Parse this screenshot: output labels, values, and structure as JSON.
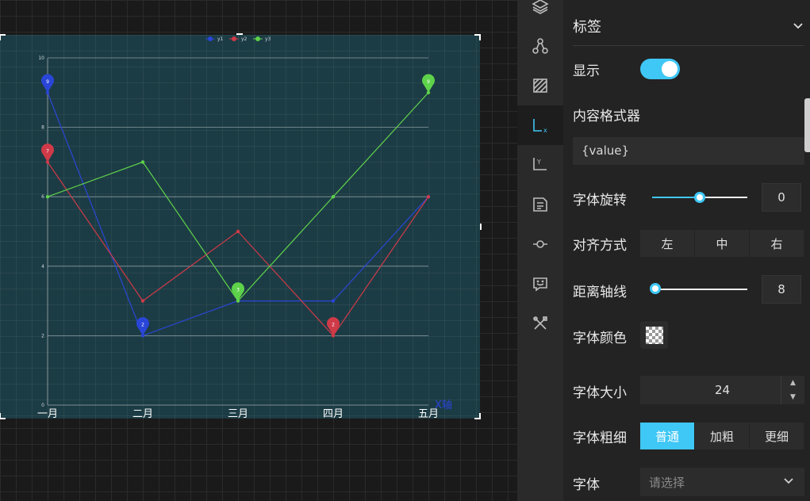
{
  "canvas": {
    "chart_data": {
      "type": "line",
      "categories": [
        "一月",
        "二月",
        "三月",
        "四月",
        "五月"
      ],
      "series": [
        {
          "name": "y1",
          "color": "#2a46d8",
          "values": [
            9,
            2,
            3,
            3,
            6
          ]
        },
        {
          "name": "y2",
          "color": "#cf3a48",
          "values": [
            7,
            3,
            5,
            2,
            6
          ]
        },
        {
          "name": "y3",
          "color": "#5ed24a",
          "values": [
            6,
            7,
            3,
            6,
            9
          ]
        }
      ],
      "ylim": [
        0,
        10
      ],
      "y_ticks": [
        "0",
        "2",
        "4",
        "6",
        "8",
        "10"
      ],
      "xlabel": "X轴",
      "grid": true,
      "legend": "top-center",
      "markers": [
        {
          "series": 0,
          "index": 0,
          "label": "9"
        },
        {
          "series": 0,
          "index": 1,
          "label": "2"
        },
        {
          "series": 1,
          "index": 0,
          "label": "7"
        },
        {
          "series": 1,
          "index": 3,
          "label": "2"
        },
        {
          "series": 2,
          "index": 2,
          "label": "3"
        },
        {
          "series": 2,
          "index": 4,
          "label": "9"
        }
      ]
    }
  },
  "rail": {
    "items": [
      {
        "icon": "layers-icon"
      },
      {
        "icon": "nodes-icon"
      },
      {
        "icon": "grid-pattern-icon"
      },
      {
        "icon": "x-axis-icon",
        "active": true
      },
      {
        "icon": "y-axis-icon"
      },
      {
        "icon": "legend-list-icon"
      },
      {
        "icon": "line-point-icon"
      },
      {
        "icon": "tooltip-icon"
      },
      {
        "icon": "tools-icon"
      }
    ]
  },
  "panel": {
    "section_title": "标签",
    "show_label": "显示",
    "show_enabled": true,
    "formatter_label": "内容格式器",
    "formatter_value": "{value}",
    "rotate_label": "字体旋转",
    "rotate_value": "0",
    "rotate_fraction": 0.5,
    "align_label": "对齐方式",
    "align_options": [
      "左",
      "中",
      "右"
    ],
    "distance_label": "距离轴线",
    "distance_value": "8",
    "distance_fraction": 0.0,
    "color_label": "字体颜色",
    "size_label": "字体大小",
    "size_value": "24",
    "weight_label": "字体粗细",
    "weight_options": [
      "普通",
      "加粗",
      "更细"
    ],
    "weight_selected": 0,
    "font_label": "字体",
    "font_placeholder": "请选择",
    "colors": {
      "accent": "#3fc7f5"
    }
  }
}
